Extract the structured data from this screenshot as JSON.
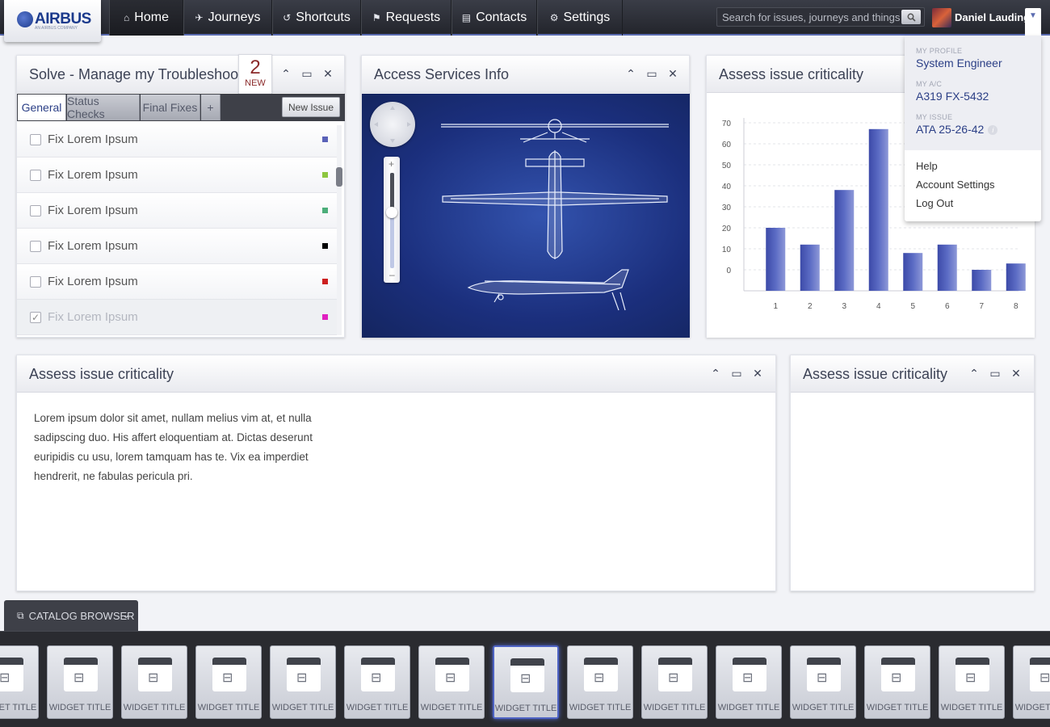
{
  "brand": {
    "name": "AIRBUS",
    "tagline": "AN AIRBUS COMPANY"
  },
  "nav": [
    {
      "label": "Home",
      "icon": "home-icon",
      "glyph": "⌂"
    },
    {
      "label": "Journeys",
      "icon": "plane-icon",
      "glyph": "✈"
    },
    {
      "label": "Shortcuts",
      "icon": "arrow-icon",
      "glyph": "↺"
    },
    {
      "label": "Requests",
      "icon": "flag-icon",
      "glyph": "⚑"
    },
    {
      "label": "Contacts",
      "icon": "book-icon",
      "glyph": "▤"
    },
    {
      "label": "Settings",
      "icon": "gear-icon",
      "glyph": "⚙"
    }
  ],
  "search": {
    "placeholder": "Search for issues, journeys and things"
  },
  "user": {
    "name": "Daniel Lauding"
  },
  "profile": {
    "my_profile_label": "MY PROFILE",
    "my_profile": "System Engineer",
    "my_ac_label": "MY A/C",
    "my_ac": "A319 FX-5432",
    "my_issue_label": "MY ISSUE",
    "my_issue": "ATA 25-26-42",
    "links": [
      "Help",
      "Account Settings",
      "Log Out"
    ]
  },
  "solve": {
    "title": "Solve - Manage my Troubleshooting",
    "badge_count": "2",
    "badge_text": "NEW",
    "tabs": [
      "General",
      "Status Checks",
      "Final Fixes",
      "+"
    ],
    "new_issue": "New Issue",
    "items": [
      {
        "label": "Fix Lorem Ipsum",
        "color": "#5a62b8",
        "done": false
      },
      {
        "label": "Fix Lorem Ipsum",
        "color": "#8dc63f",
        "done": false
      },
      {
        "label": "Fix Lorem Ipsum",
        "color": "#4cae7a",
        "done": false
      },
      {
        "label": "Fix Lorem Ipsum",
        "color": "#000000",
        "done": false
      },
      {
        "label": "Fix Lorem Ipsum",
        "color": "#cc1f1f",
        "done": false
      },
      {
        "label": "Fix Lorem Ipsum",
        "color": "#e020c0",
        "done": true
      }
    ]
  },
  "access": {
    "title": "Access Services Info"
  },
  "criticality_chart": {
    "title": "Assess issue criticality"
  },
  "chart_data": {
    "type": "bar",
    "categories": [
      "1",
      "2",
      "3",
      "4",
      "5",
      "6",
      "7",
      "8"
    ],
    "values": [
      20,
      12,
      38,
      67,
      8,
      12,
      0,
      3
    ],
    "ylim": [
      0,
      70
    ],
    "yticks": [
      0,
      10,
      20,
      30,
      40,
      50,
      60,
      70
    ],
    "title": "",
    "xlabel": "",
    "ylabel": "",
    "bar_color": "#5b6bc4",
    "grid": true
  },
  "text_widget": {
    "title": "Assess issue criticality",
    "body": "Lorem ipsum dolor sit amet, nullam melius vim at, et nulla sadipscing duo. His affert eloquentiam at. Dictas deserunt euripidis cu usu, lorem tamquam has te. Vix ea imperdiet hendrerit, ne fabulas pericula pri."
  },
  "empty_widget": {
    "title": "Assess issue criticality"
  },
  "catalog": {
    "label": "CATALOG BROWSER",
    "tiles": [
      "WIDGET TITLE",
      "WIDGET TITLE",
      "WIDGET TITLE",
      "WIDGET TITLE",
      "WIDGET TITLE",
      "WIDGET TITLE",
      "WIDGET TITLE",
      "WIDGET TITLE",
      "WIDGET TITLE",
      "WIDGET TITLE",
      "WIDGET TITLE",
      "WIDGET TITLE",
      "WIDGET TITLE",
      "WIDGET TITLE",
      "WIDGET TITLE"
    ],
    "selected_index": 7
  }
}
